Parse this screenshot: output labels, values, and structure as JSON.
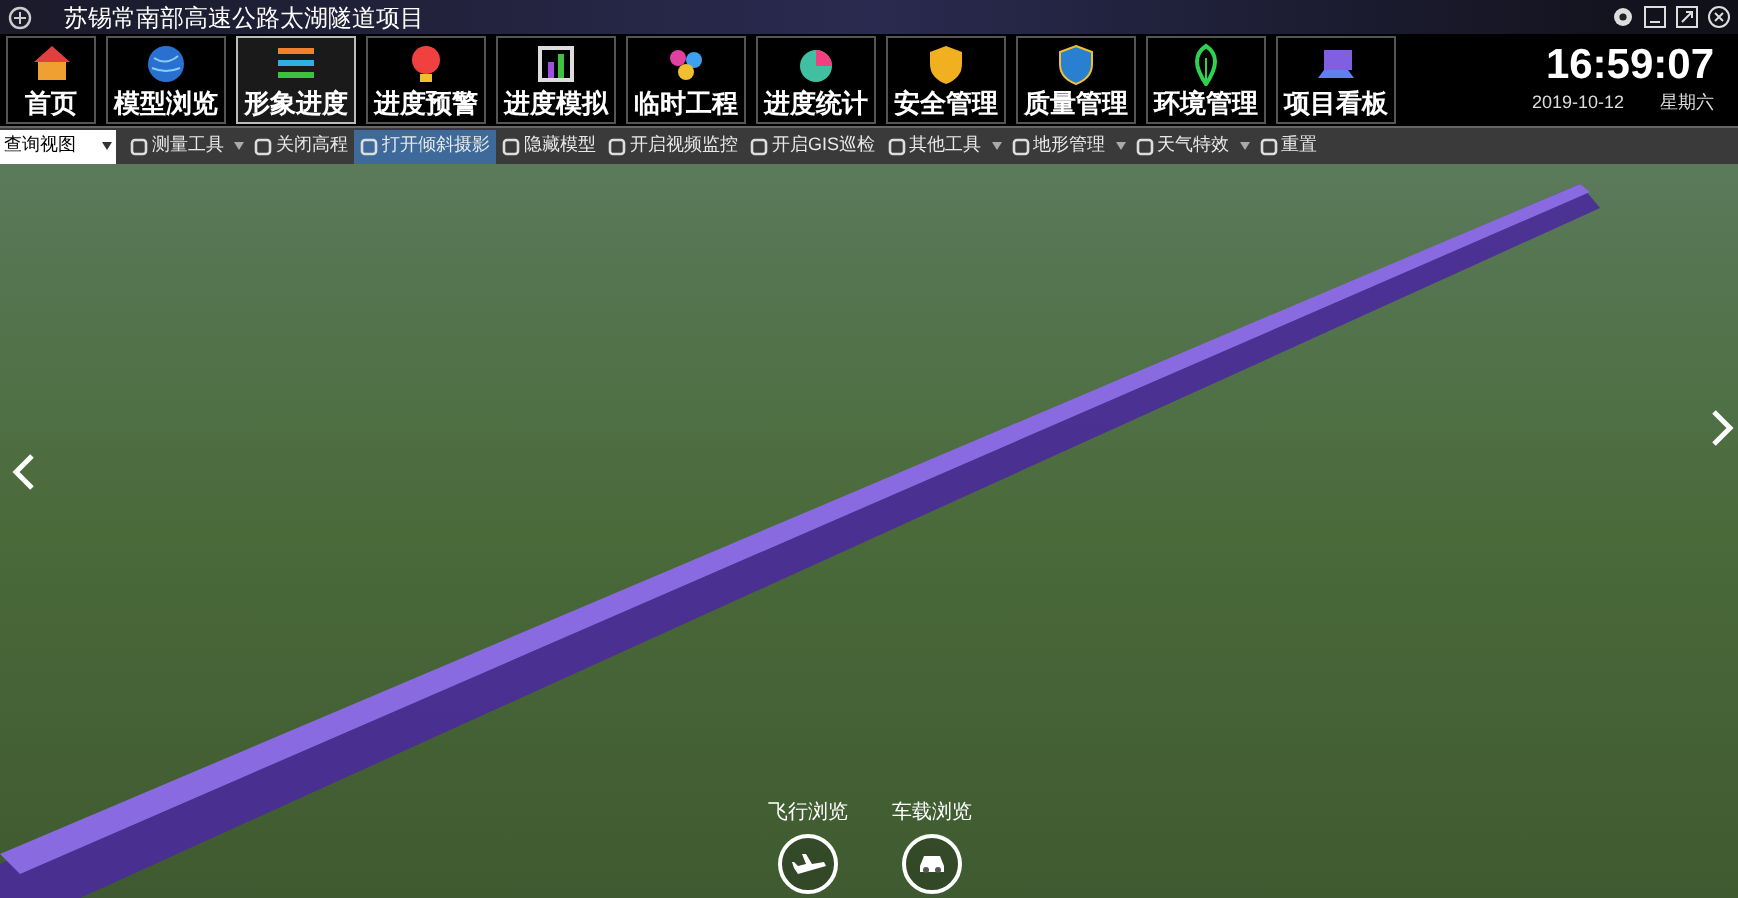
{
  "window": {
    "title": "苏锡常南部高速公路太湖隧道项目"
  },
  "nav": [
    {
      "label": "首页",
      "selected": false
    },
    {
      "label": "模型浏览",
      "selected": false
    },
    {
      "label": "形象进度",
      "selected": true
    },
    {
      "label": "进度预警",
      "selected": false
    },
    {
      "label": "进度模拟",
      "selected": false
    },
    {
      "label": "临时工程",
      "selected": false
    },
    {
      "label": "进度统计",
      "selected": false
    },
    {
      "label": "安全管理",
      "selected": false
    },
    {
      "label": "质量管理",
      "selected": false
    },
    {
      "label": "环境管理",
      "selected": false
    },
    {
      "label": "项目看板",
      "selected": false
    }
  ],
  "clock": {
    "time": "16:59:07",
    "date": "2019-10-12",
    "weekday": "星期六"
  },
  "toolbar": {
    "view_select": "查询视图",
    "tools": [
      {
        "label": "测量工具",
        "dropdown": true,
        "selected": false
      },
      {
        "label": "关闭高程",
        "dropdown": false,
        "selected": false
      },
      {
        "label": "打开倾斜摄影",
        "dropdown": false,
        "selected": true
      },
      {
        "label": "隐藏模型",
        "dropdown": false,
        "selected": false
      },
      {
        "label": "开启视频监控",
        "dropdown": false,
        "selected": false
      },
      {
        "label": "开启GIS巡检",
        "dropdown": false,
        "selected": false
      },
      {
        "label": "其他工具",
        "dropdown": true,
        "selected": false
      },
      {
        "label": "地形管理",
        "dropdown": true,
        "selected": false
      },
      {
        "label": "天气特效",
        "dropdown": true,
        "selected": false
      },
      {
        "label": "重置",
        "dropdown": false,
        "selected": false
      }
    ]
  },
  "map": {
    "browse_modes": [
      {
        "label": "飞行浏览",
        "kind": "plane"
      },
      {
        "label": "车载浏览",
        "kind": "car"
      }
    ]
  }
}
